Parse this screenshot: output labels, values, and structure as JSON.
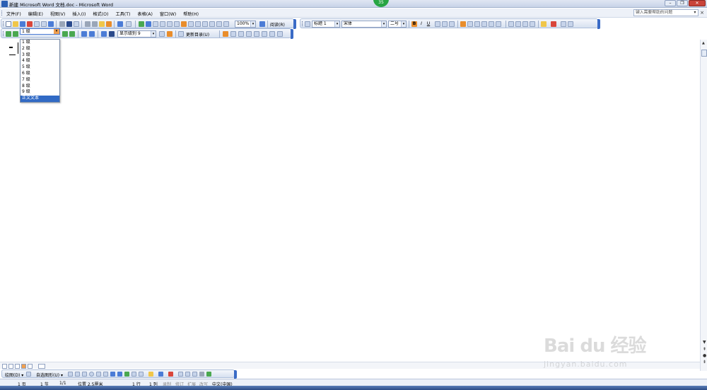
{
  "window": {
    "title": "新建 Microsoft Word 文档.doc - Microsoft Word",
    "badge": "35"
  },
  "menubar": {
    "items": [
      "文件(F)",
      "编辑(E)",
      "视图(V)",
      "插入(I)",
      "格式(O)",
      "工具(T)",
      "表格(A)",
      "窗口(W)",
      "帮助(H)"
    ],
    "help_placeholder": "键入需要帮助的问题",
    "close_doc": "×"
  },
  "standard_toolbar": {
    "zoom": "100%",
    "read_label": "阅读(R)"
  },
  "formatting_toolbar": {
    "style": "标题 1",
    "font": "宋体",
    "size": "二号",
    "bold": "B",
    "italic": "I",
    "underline": "U"
  },
  "outlining_toolbar": {
    "level": "1 级",
    "show_level": "显示级别 9",
    "update_toc": "更新目录(U)",
    "level_options": [
      "1 级",
      "2 级",
      "3 级",
      "4 级",
      "5 级",
      "6 级",
      "7 级",
      "8 级",
      "9 级",
      "正文文本"
    ],
    "selected_option": "正文文本"
  },
  "drawing_toolbar": {
    "draw_label": "绘图(D) ▾",
    "autoshapes_label": "自选图形(U) ▾"
  },
  "statusbar": {
    "page": "1 页",
    "section": "1 节",
    "page_of": "1/1",
    "position": "位置 2.5厘米",
    "line": "1 行",
    "column": "1 列",
    "rec": "录制",
    "trk": "修订",
    "ext": "扩展",
    "ovr": "改写",
    "language": "中文(中国)"
  },
  "watermark": {
    "brand": "Bai du 经验",
    "url": "jingyan.baidu.com"
  },
  "colors": {
    "titlebar": "#c9d4e8",
    "toolbar_accent": "#3a6bc6",
    "selection": "#316ac5",
    "badge": "#27a543"
  }
}
